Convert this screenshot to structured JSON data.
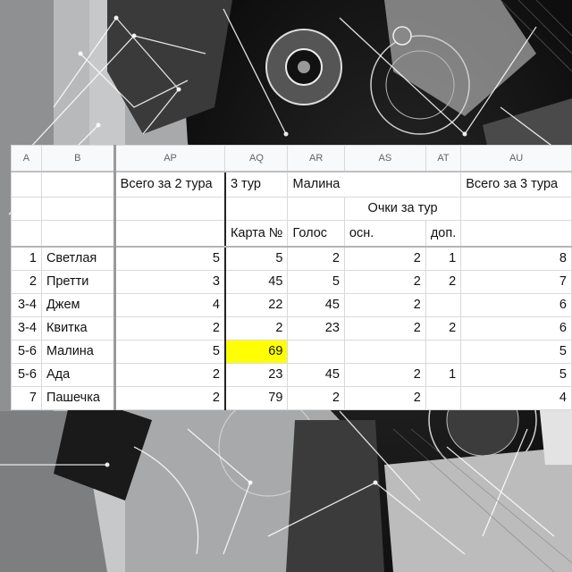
{
  "columns": [
    "A",
    "B",
    "AP",
    "AQ",
    "AR",
    "AS",
    "AT",
    "AU"
  ],
  "header": {
    "total_2": "Всего за 2 тура",
    "tour_3": "3 тур",
    "malina": "Малина",
    "points_per_tour": "Очки за тур",
    "total_3": "Всего за 3 тура",
    "card_no": "Карта №",
    "vote": "Голос",
    "main": "осн.",
    "extra": "доп."
  },
  "rows": [
    {
      "rank": "1",
      "name": "Светлая",
      "total2": "5",
      "card": "5",
      "vote": "2",
      "main": "2",
      "extra": "1",
      "total3": "8"
    },
    {
      "rank": "2",
      "name": "Претти",
      "total2": "3",
      "card": "45",
      "vote": "5",
      "main": "2",
      "extra": "2",
      "total3": "7"
    },
    {
      "rank": "3-4",
      "name": "Джем",
      "total2": "4",
      "card": "22",
      "vote": "45",
      "main": "2",
      "extra": "",
      "total3": "6"
    },
    {
      "rank": "3-4",
      "name": "Квитка",
      "total2": "2",
      "card": "2",
      "vote": "23",
      "main": "2",
      "extra": "2",
      "total3": "6"
    },
    {
      "rank": "5-6",
      "name": "Малина",
      "total2": "5",
      "card": "69",
      "vote": "",
      "main": "",
      "extra": "",
      "total3": "5"
    },
    {
      "rank": "5-6",
      "name": "Ада",
      "total2": "2",
      "card": "23",
      "vote": "45",
      "main": "2",
      "extra": "1",
      "total3": "5"
    },
    {
      "rank": "7",
      "name": "Пашечка",
      "total2": "2",
      "card": "79",
      "vote": "2",
      "main": "2",
      "extra": "",
      "total3": "4"
    }
  ],
  "colors": {
    "highlight": "#ffff00",
    "header_bg": "#f8f9fa",
    "grid": "#d9d9d9"
  }
}
